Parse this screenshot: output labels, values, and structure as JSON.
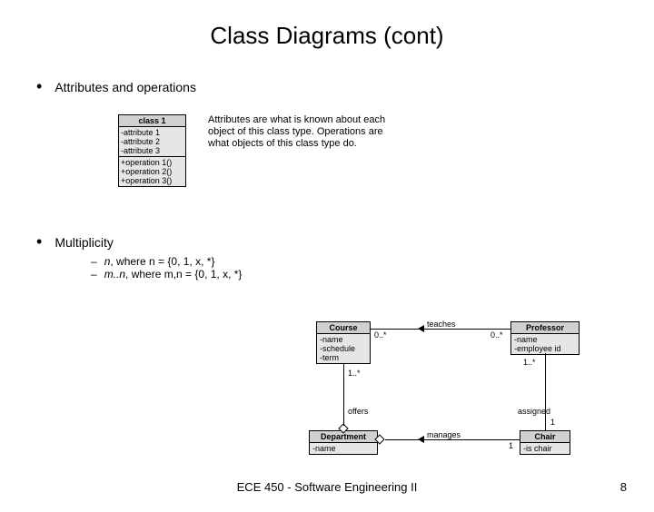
{
  "title": "Class Diagrams (cont)",
  "bullets": {
    "b1": "Attributes and operations",
    "b2": "Multiplicity"
  },
  "sub": {
    "s1_prefix": "n",
    "s1_rest": ", where n = {0, 1, x, *}",
    "s2_prefix": "m..n",
    "s2_rest": ", where m,n = {0, 1, x, *}"
  },
  "desc": "Attributes are what is known about each object of this class type. Operations are what objects of this class type do.",
  "class1": {
    "name": "class 1",
    "a1": "-attribute 1",
    "a2": "-attribute 2",
    "a3": "-attribute 3",
    "o1": "+operation 1()",
    "o2": "+operation 2()",
    "o3": "+operation 3()"
  },
  "d2": {
    "course": {
      "name": "Course",
      "a1": "-name",
      "a2": "-schedule",
      "a3": "-term"
    },
    "professor": {
      "name": "Professor",
      "a1": "-name",
      "a2": "-employee id"
    },
    "department": {
      "name": "Department",
      "a1": "-name"
    },
    "chair": {
      "name": "Chair",
      "a1": "-is chair"
    },
    "labels": {
      "teaches": "teaches",
      "offers": "offers",
      "assigned": "assigned",
      "manages": "manages",
      "m0s": "0..*",
      "m0s2": "0..*",
      "m1s": "1..*",
      "m1s2": "1..*",
      "m1": "1",
      "m1b": "1"
    }
  },
  "footer": {
    "center": "ECE 450 - Software Engineering II",
    "page": "8"
  }
}
